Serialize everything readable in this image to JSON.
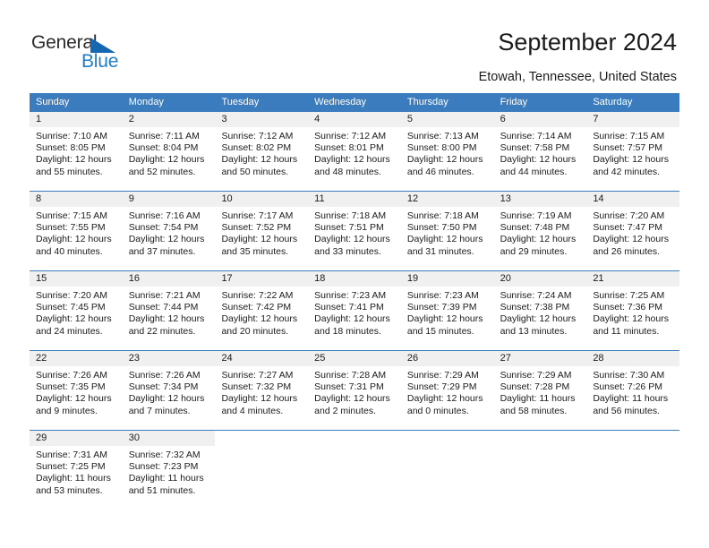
{
  "brand": {
    "name_part1": "General",
    "name_part2": "Blue",
    "triangle_color": "#1667b1",
    "blue_color": "#1f7fc4"
  },
  "header": {
    "title": "September 2024",
    "subtitle": "Etowah, Tennessee, United States"
  },
  "theme": {
    "header_row_bg": "#3a7cbe",
    "daynum_bg": "#f0f0f0",
    "week_border": "#3a7cbe"
  },
  "weekdays": [
    "Sunday",
    "Monday",
    "Tuesday",
    "Wednesday",
    "Thursday",
    "Friday",
    "Saturday"
  ],
  "weeks": [
    [
      {
        "day": "1",
        "sunrise": "Sunrise: 7:10 AM",
        "sunset": "Sunset: 8:05 PM",
        "daylight1": "Daylight: 12 hours",
        "daylight2": "and 55 minutes."
      },
      {
        "day": "2",
        "sunrise": "Sunrise: 7:11 AM",
        "sunset": "Sunset: 8:04 PM",
        "daylight1": "Daylight: 12 hours",
        "daylight2": "and 52 minutes."
      },
      {
        "day": "3",
        "sunrise": "Sunrise: 7:12 AM",
        "sunset": "Sunset: 8:02 PM",
        "daylight1": "Daylight: 12 hours",
        "daylight2": "and 50 minutes."
      },
      {
        "day": "4",
        "sunrise": "Sunrise: 7:12 AM",
        "sunset": "Sunset: 8:01 PM",
        "daylight1": "Daylight: 12 hours",
        "daylight2": "and 48 minutes."
      },
      {
        "day": "5",
        "sunrise": "Sunrise: 7:13 AM",
        "sunset": "Sunset: 8:00 PM",
        "daylight1": "Daylight: 12 hours",
        "daylight2": "and 46 minutes."
      },
      {
        "day": "6",
        "sunrise": "Sunrise: 7:14 AM",
        "sunset": "Sunset: 7:58 PM",
        "daylight1": "Daylight: 12 hours",
        "daylight2": "and 44 minutes."
      },
      {
        "day": "7",
        "sunrise": "Sunrise: 7:15 AM",
        "sunset": "Sunset: 7:57 PM",
        "daylight1": "Daylight: 12 hours",
        "daylight2": "and 42 minutes."
      }
    ],
    [
      {
        "day": "8",
        "sunrise": "Sunrise: 7:15 AM",
        "sunset": "Sunset: 7:55 PM",
        "daylight1": "Daylight: 12 hours",
        "daylight2": "and 40 minutes."
      },
      {
        "day": "9",
        "sunrise": "Sunrise: 7:16 AM",
        "sunset": "Sunset: 7:54 PM",
        "daylight1": "Daylight: 12 hours",
        "daylight2": "and 37 minutes."
      },
      {
        "day": "10",
        "sunrise": "Sunrise: 7:17 AM",
        "sunset": "Sunset: 7:52 PM",
        "daylight1": "Daylight: 12 hours",
        "daylight2": "and 35 minutes."
      },
      {
        "day": "11",
        "sunrise": "Sunrise: 7:18 AM",
        "sunset": "Sunset: 7:51 PM",
        "daylight1": "Daylight: 12 hours",
        "daylight2": "and 33 minutes."
      },
      {
        "day": "12",
        "sunrise": "Sunrise: 7:18 AM",
        "sunset": "Sunset: 7:50 PM",
        "daylight1": "Daylight: 12 hours",
        "daylight2": "and 31 minutes."
      },
      {
        "day": "13",
        "sunrise": "Sunrise: 7:19 AM",
        "sunset": "Sunset: 7:48 PM",
        "daylight1": "Daylight: 12 hours",
        "daylight2": "and 29 minutes."
      },
      {
        "day": "14",
        "sunrise": "Sunrise: 7:20 AM",
        "sunset": "Sunset: 7:47 PM",
        "daylight1": "Daylight: 12 hours",
        "daylight2": "and 26 minutes."
      }
    ],
    [
      {
        "day": "15",
        "sunrise": "Sunrise: 7:20 AM",
        "sunset": "Sunset: 7:45 PM",
        "daylight1": "Daylight: 12 hours",
        "daylight2": "and 24 minutes."
      },
      {
        "day": "16",
        "sunrise": "Sunrise: 7:21 AM",
        "sunset": "Sunset: 7:44 PM",
        "daylight1": "Daylight: 12 hours",
        "daylight2": "and 22 minutes."
      },
      {
        "day": "17",
        "sunrise": "Sunrise: 7:22 AM",
        "sunset": "Sunset: 7:42 PM",
        "daylight1": "Daylight: 12 hours",
        "daylight2": "and 20 minutes."
      },
      {
        "day": "18",
        "sunrise": "Sunrise: 7:23 AM",
        "sunset": "Sunset: 7:41 PM",
        "daylight1": "Daylight: 12 hours",
        "daylight2": "and 18 minutes."
      },
      {
        "day": "19",
        "sunrise": "Sunrise: 7:23 AM",
        "sunset": "Sunset: 7:39 PM",
        "daylight1": "Daylight: 12 hours",
        "daylight2": "and 15 minutes."
      },
      {
        "day": "20",
        "sunrise": "Sunrise: 7:24 AM",
        "sunset": "Sunset: 7:38 PM",
        "daylight1": "Daylight: 12 hours",
        "daylight2": "and 13 minutes."
      },
      {
        "day": "21",
        "sunrise": "Sunrise: 7:25 AM",
        "sunset": "Sunset: 7:36 PM",
        "daylight1": "Daylight: 12 hours",
        "daylight2": "and 11 minutes."
      }
    ],
    [
      {
        "day": "22",
        "sunrise": "Sunrise: 7:26 AM",
        "sunset": "Sunset: 7:35 PM",
        "daylight1": "Daylight: 12 hours",
        "daylight2": "and 9 minutes."
      },
      {
        "day": "23",
        "sunrise": "Sunrise: 7:26 AM",
        "sunset": "Sunset: 7:34 PM",
        "daylight1": "Daylight: 12 hours",
        "daylight2": "and 7 minutes."
      },
      {
        "day": "24",
        "sunrise": "Sunrise: 7:27 AM",
        "sunset": "Sunset: 7:32 PM",
        "daylight1": "Daylight: 12 hours",
        "daylight2": "and 4 minutes."
      },
      {
        "day": "25",
        "sunrise": "Sunrise: 7:28 AM",
        "sunset": "Sunset: 7:31 PM",
        "daylight1": "Daylight: 12 hours",
        "daylight2": "and 2 minutes."
      },
      {
        "day": "26",
        "sunrise": "Sunrise: 7:29 AM",
        "sunset": "Sunset: 7:29 PM",
        "daylight1": "Daylight: 12 hours",
        "daylight2": "and 0 minutes."
      },
      {
        "day": "27",
        "sunrise": "Sunrise: 7:29 AM",
        "sunset": "Sunset: 7:28 PM",
        "daylight1": "Daylight: 11 hours",
        "daylight2": "and 58 minutes."
      },
      {
        "day": "28",
        "sunrise": "Sunrise: 7:30 AM",
        "sunset": "Sunset: 7:26 PM",
        "daylight1": "Daylight: 11 hours",
        "daylight2": "and 56 minutes."
      }
    ],
    [
      {
        "day": "29",
        "sunrise": "Sunrise: 7:31 AM",
        "sunset": "Sunset: 7:25 PM",
        "daylight1": "Daylight: 11 hours",
        "daylight2": "and 53 minutes."
      },
      {
        "day": "30",
        "sunrise": "Sunrise: 7:32 AM",
        "sunset": "Sunset: 7:23 PM",
        "daylight1": "Daylight: 11 hours",
        "daylight2": "and 51 minutes."
      },
      {
        "day": "",
        "sunrise": "",
        "sunset": "",
        "daylight1": "",
        "daylight2": ""
      },
      {
        "day": "",
        "sunrise": "",
        "sunset": "",
        "daylight1": "",
        "daylight2": ""
      },
      {
        "day": "",
        "sunrise": "",
        "sunset": "",
        "daylight1": "",
        "daylight2": ""
      },
      {
        "day": "",
        "sunrise": "",
        "sunset": "",
        "daylight1": "",
        "daylight2": ""
      },
      {
        "day": "",
        "sunrise": "",
        "sunset": "",
        "daylight1": "",
        "daylight2": ""
      }
    ]
  ]
}
